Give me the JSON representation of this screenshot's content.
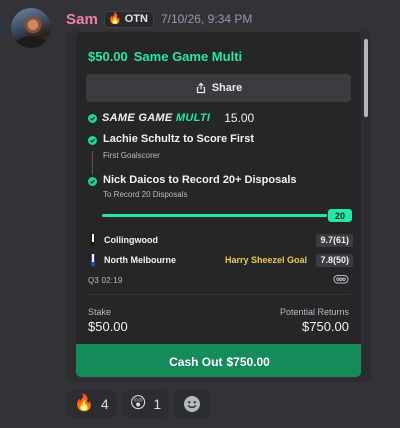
{
  "message": {
    "username": "Sam",
    "tag": {
      "emoji": "🔥",
      "label": "OTN"
    },
    "timestamp": "7/10/26, 9:34 PM"
  },
  "bet": {
    "amount_title": "$50.00",
    "bet_type": "Same Game Multi",
    "share_label": "Share",
    "sgm_label_part1": "SAME GAME",
    "sgm_label_part2": "MULTI",
    "sgm_odds": "15.00",
    "legs": [
      {
        "title": "Lachie Schultz to Score First",
        "subtitle": "First Goalscorer"
      },
      {
        "title": "Nick Daicos to Record 20+ Disposals",
        "subtitle": "To Record 20 Disposals"
      }
    ],
    "progress": {
      "current": 20,
      "target": 20,
      "badge": "20"
    },
    "teams": [
      {
        "name": "Collingwood",
        "score": "9.7(61)",
        "note": ""
      },
      {
        "name": "North Melbourne",
        "score": "7.8(50)",
        "note": "Harry Sheezel Goal"
      }
    ],
    "game_clock": "Q3  02:19",
    "stake_label": "Stake",
    "stake_value": "$50.00",
    "returns_label": "Potential Returns",
    "returns_value": "$750.00",
    "cashout_label": "Cash Out",
    "cashout_value": "$750.00"
  },
  "reactions": [
    {
      "emoji": "🔥",
      "count": "4"
    },
    {
      "emoji": "😲",
      "count": "1"
    }
  ],
  "colors": {
    "username": "#f47fab",
    "accent_green": "#27e7a4",
    "cashout_green": "#158a5b",
    "goal_yellow": "#f2c94c",
    "background": "#313338"
  },
  "icons": [
    "avatar",
    "fire-icon",
    "share-icon",
    "check-icon",
    "team-stripes-icon",
    "tv-icon",
    "add-reaction-icon"
  ]
}
